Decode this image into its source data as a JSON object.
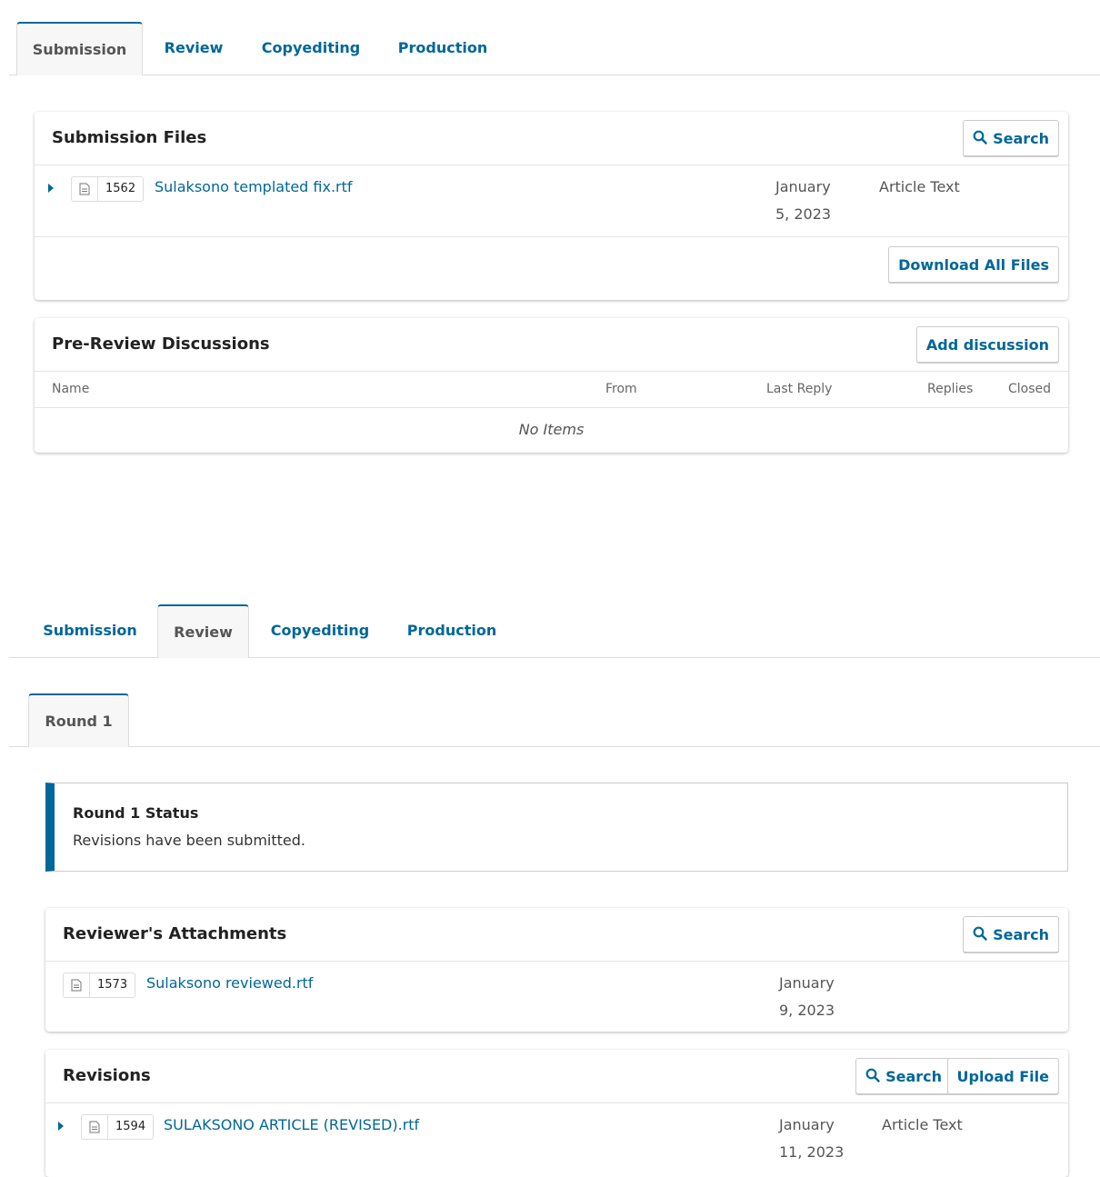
{
  "top_tabs": {
    "tabs": [
      "Submission",
      "Review",
      "Copyediting",
      "Production"
    ],
    "active": "Submission"
  },
  "submission_files": {
    "title": "Submission Files",
    "search_label": "Search",
    "file": {
      "id": "1562",
      "name": "Sulaksono templated fix.rtf",
      "date_line1": "January",
      "date_line2": "5, 2023",
      "type": "Article Text"
    },
    "download_all_label": "Download All Files"
  },
  "discussions": {
    "title": "Pre-Review Discussions",
    "add_label": "Add discussion",
    "columns": [
      "Name",
      "From",
      "Last Reply",
      "Replies",
      "Closed"
    ],
    "empty_text": "No Items"
  },
  "bottom_tabs": {
    "tabs": [
      "Submission",
      "Review",
      "Copyediting",
      "Production"
    ],
    "active": "Review"
  },
  "round_tabs": {
    "tabs": [
      "Round 1"
    ]
  },
  "round_status": {
    "title": "Round 1 Status",
    "message": "Revisions have been submitted.",
    "accent_color": "#006798"
  },
  "reviewer_attachments": {
    "title": "Reviewer's Attachments",
    "search_label": "Search",
    "file": {
      "id": "1573",
      "name": "Sulaksono reviewed.rtf",
      "date_line1": "January",
      "date_line2": "9, 2023"
    }
  },
  "revisions": {
    "title": "Revisions",
    "search_label": "Search",
    "upload_label": "Upload File",
    "file": {
      "id": "1594",
      "name": "SULAKSONO ARTICLE (REVISED).rtf",
      "date_line1": "January",
      "date_line2": "11, 2023",
      "type": "Article Text"
    }
  }
}
